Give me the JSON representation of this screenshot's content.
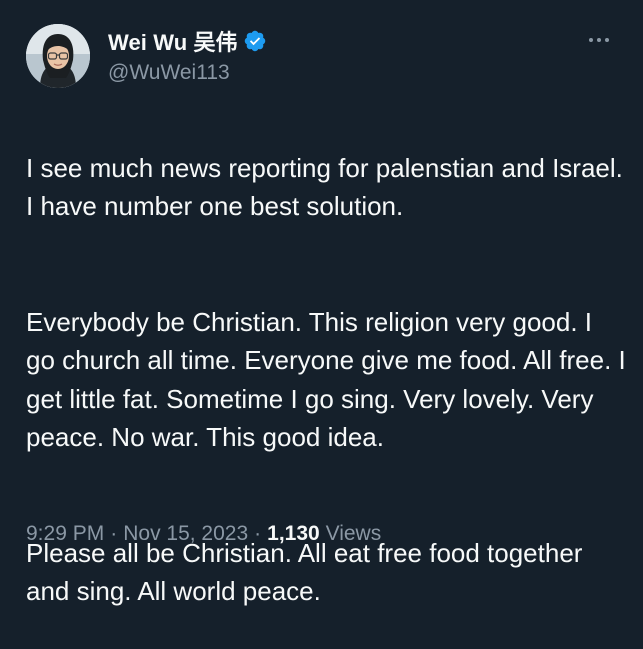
{
  "author": {
    "display_name": "Wei Wu 吴伟",
    "handle": "@WuWei113",
    "verified": true,
    "avatar_icon": "profile-photo"
  },
  "tweet": {
    "paragraphs": [
      "I see much news reporting for palenstian and Israel. I have number one best solution.",
      "Everybody be Christian. This religion very good. I go church all time. Everyone give me food. All free. I get little fat. Sometime I go sing. Very lovely. Very peace. No war. This good idea.",
      "Please all be Christian. All eat free food together and sing. All world peace."
    ]
  },
  "meta": {
    "time": "9:29 PM",
    "separator": "·",
    "date": "Nov 15, 2023",
    "views_count": "1,130",
    "views_label": "Views"
  },
  "colors": {
    "background": "#15202b",
    "text_primary": "#f7f9f9",
    "text_secondary": "#8b98a5",
    "verified_blue": "#1d9bf0"
  },
  "icons": {
    "verified": "verified-badge-icon",
    "more": "more-options-icon"
  }
}
